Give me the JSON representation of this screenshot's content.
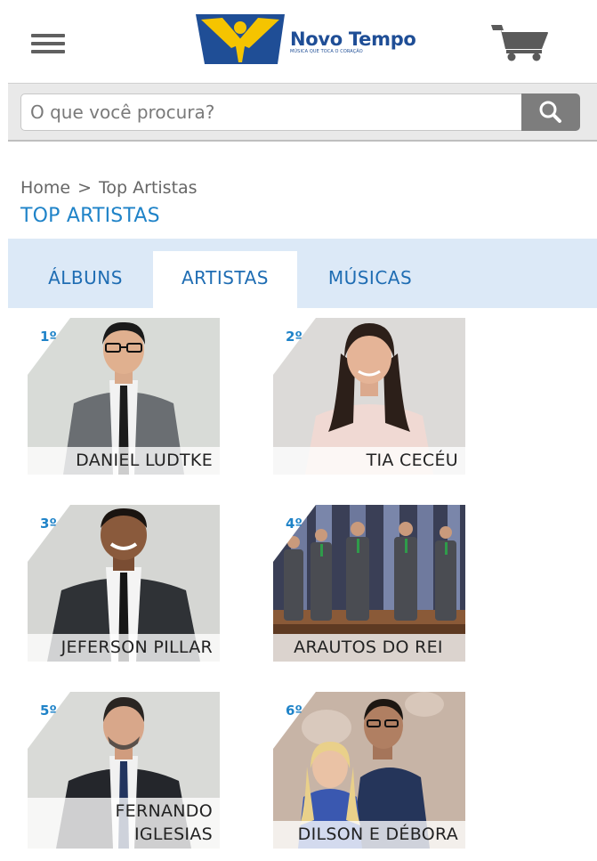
{
  "header": {
    "logo_name": "Novo Tempo",
    "logo_tagline": "MÚSICA QUE TOCA O CORAÇÃO",
    "menu_icon": "hamburger-menu-icon",
    "cart_icon": "shopping-cart-icon",
    "colors": {
      "logo_blue": "#1f4e96",
      "logo_yellow": "#f5c400",
      "icon_gray": "#606060"
    }
  },
  "search": {
    "placeholder": "O que você procura?",
    "value": "",
    "button_icon": "search-icon"
  },
  "breadcrumb": {
    "items": [
      "Home",
      "Top Artistas"
    ],
    "separator": ">"
  },
  "page": {
    "title": "TOP ARTISTAS",
    "accent_color": "#1f83c8"
  },
  "tabs": [
    {
      "label": "ÁLBUNS",
      "active": false
    },
    {
      "label": "ARTISTAS",
      "active": true
    },
    {
      "label": "MÚSICAS",
      "active": false
    }
  ],
  "artists": [
    {
      "rank": "1º",
      "name": "DANIEL LUDTKE"
    },
    {
      "rank": "2º",
      "name": "TIA CECÉU"
    },
    {
      "rank": "3º",
      "name": "JEFERSON PILLAR"
    },
    {
      "rank": "4º",
      "name": "ARAUTOS DO REI"
    },
    {
      "rank": "5º",
      "name": "FERNANDO IGLESIAS"
    },
    {
      "rank": "6º",
      "name": "DILSON E DÉBORA"
    }
  ]
}
